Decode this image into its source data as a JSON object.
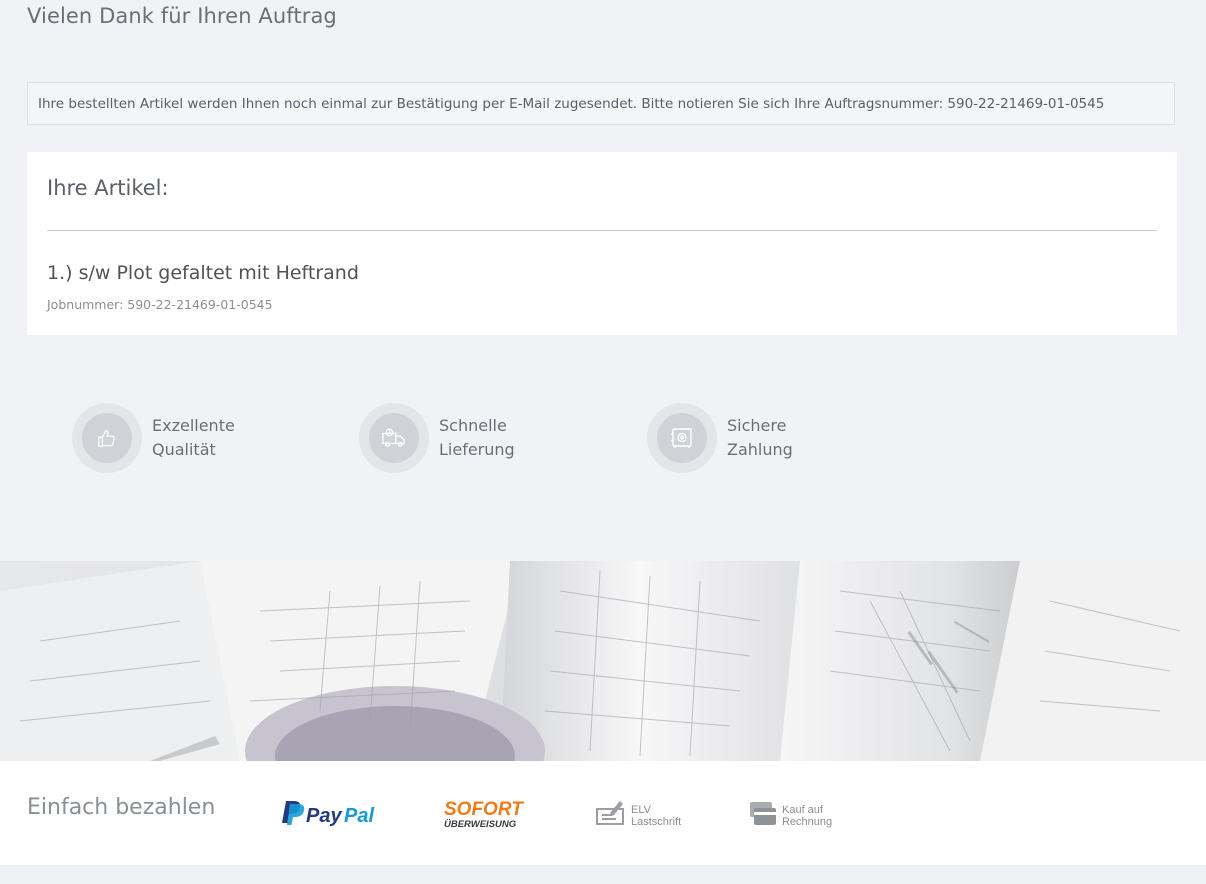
{
  "page": {
    "title": "Vielen Dank für Ihren Auftrag"
  },
  "notice": {
    "text": "Ihre bestellten Artikel werden Ihnen noch einmal zur Bestätigung per E-Mail zugesendet. Bitte notieren Sie sich Ihre Auftragsnummer: 590-22-21469-01-0545"
  },
  "articles": {
    "title": "Ihre Artikel:",
    "items": [
      {
        "name": "1.) s/w Plot gefaltet mit Heftrand",
        "job_label": "Jobnummer:",
        "job_number": "590-22-21469-01-0545"
      }
    ]
  },
  "features": [
    {
      "icon": "thumbs-up-icon",
      "line1": "Exzellente",
      "line2": "Qualität"
    },
    {
      "icon": "delivery-truck-icon",
      "line1": "Schnelle",
      "line2": "Lieferung"
    },
    {
      "icon": "safe-icon",
      "line1": "Sichere",
      "line2": "Zahlung"
    }
  ],
  "payment": {
    "title": "Einfach bezahlen",
    "methods": [
      {
        "icon": "paypal-logo",
        "label": "PayPal"
      },
      {
        "icon": "sofort-logo",
        "label": "SOFORT",
        "sub": "ÜBERWEISUNG"
      },
      {
        "icon": "elv-icon",
        "label": "ELV",
        "sub": "Lastschrift"
      },
      {
        "icon": "invoice-icon",
        "label": "Kauf auf",
        "sub": "Rechnung"
      }
    ]
  },
  "colors": {
    "page_bg": "#f1f2f5",
    "paypal_dark": "#253b80",
    "paypal_light": "#179bd7",
    "sofort_orange": "#ef7b1a"
  }
}
